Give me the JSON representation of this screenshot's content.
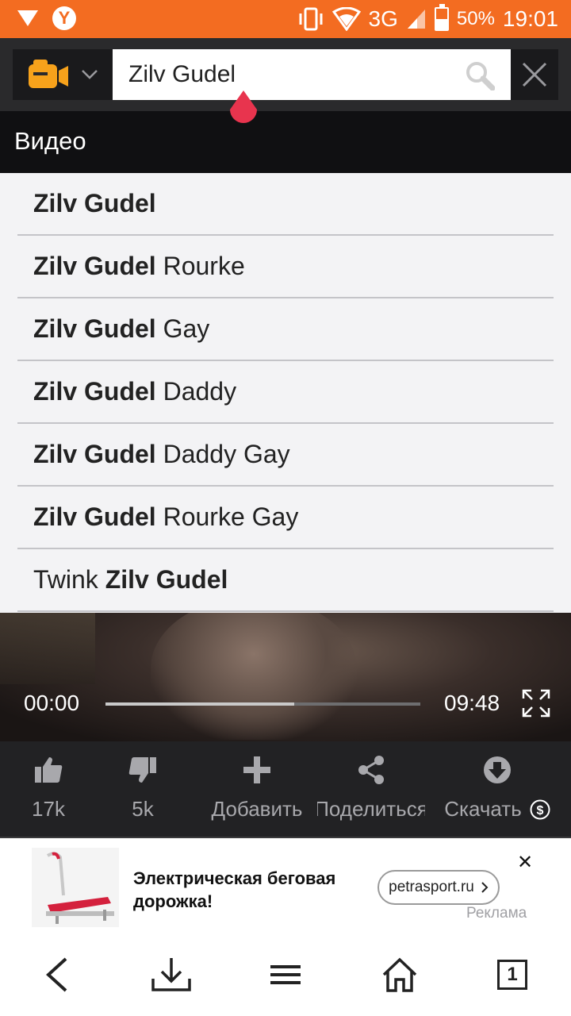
{
  "status_bar": {
    "network": "3G",
    "battery": "50%",
    "time": "19:01"
  },
  "search": {
    "query": "Zilv Gudel",
    "placeholder": ""
  },
  "section_title": "Видео",
  "suggestions": [
    {
      "bold": "Zilv Gudel",
      "rest": ""
    },
    {
      "bold": "Zilv Gudel",
      "rest": " Rourke"
    },
    {
      "bold": "Zilv Gudel",
      "rest": " Gay"
    },
    {
      "bold": "Zilv Gudel",
      "rest": " Daddy"
    },
    {
      "bold": "Zilv Gudel",
      "rest": " Daddy Gay"
    },
    {
      "bold": "Zilv Gudel",
      "rest": " Rourke Gay"
    },
    {
      "prefix": "Twink ",
      "bold": "Zilv Gudel"
    }
  ],
  "player": {
    "current_time": "00:00",
    "duration": "09:48",
    "buffered_fraction": 0.6
  },
  "actions": {
    "likes": "17k",
    "dislikes": "5k",
    "add": "Добавить",
    "share": "Поделиться",
    "download": "Скачать"
  },
  "ad": {
    "headline": "Электрическая беговая дорожка!",
    "link": "petrasport.ru",
    "label": "Реклама"
  },
  "nav": {
    "tabs_count": "1"
  },
  "colors": {
    "status_bar": "#f36c21",
    "logo": "#f7a21b",
    "cursor": "#e8344e"
  }
}
